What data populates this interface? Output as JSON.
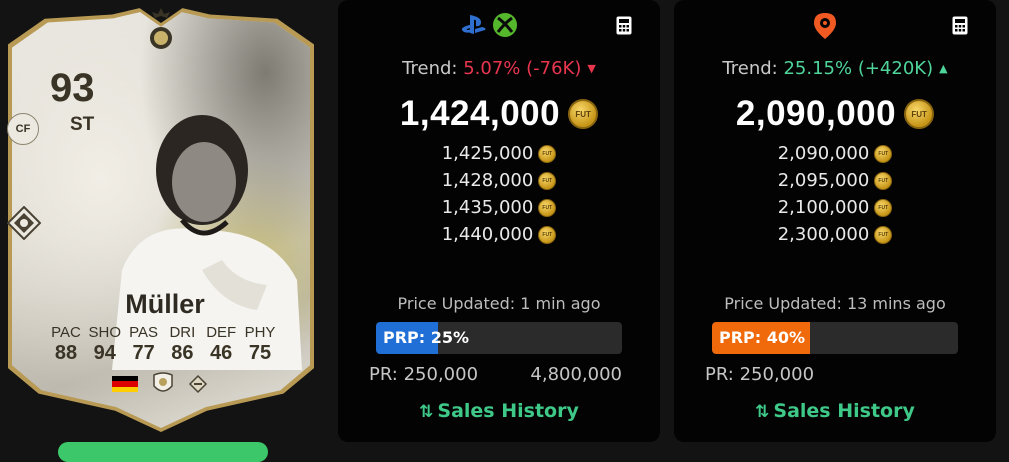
{
  "card": {
    "rating": "93",
    "position": "ST",
    "alt_position": "CF",
    "name": "Müller",
    "stats": [
      {
        "label": "PAC",
        "value": "88"
      },
      {
        "label": "SHO",
        "value": "94"
      },
      {
        "label": "PAS",
        "value": "77"
      },
      {
        "label": "DRI",
        "value": "86"
      },
      {
        "label": "DEF",
        "value": "46"
      },
      {
        "label": "PHY",
        "value": "75"
      }
    ],
    "nation_icon": "germany-flag-icon",
    "league_icon": "icons-league-icon",
    "club_icon": "icons-club-icon"
  },
  "panels": {
    "console": {
      "platform_icons": [
        "playstation-icon",
        "xbox-icon"
      ],
      "trend_label": "Trend:",
      "trend_value": "5.07% (-76K)",
      "trend_direction": "down",
      "price": "1,424,000",
      "coin_label": "FUT",
      "listings": [
        "1,425,000",
        "1,428,000",
        "1,435,000",
        "1,440,000"
      ],
      "updated": "Price Updated: 1 min ago",
      "prp_label": "PRP: 25%",
      "prp_fraction": 0.25,
      "prp_color": "#1f6fd6",
      "pr_min": "PR: 250,000",
      "pr_max": "4,800,000",
      "sales_label": "Sales History"
    },
    "pc": {
      "platform_icons": [
        "origin-icon"
      ],
      "trend_label": "Trend:",
      "trend_value": "25.15% (+420K)",
      "trend_direction": "up",
      "price": "2,090,000",
      "coin_label": "FUT",
      "listings": [
        "2,090,000",
        "2,095,000",
        "2,100,000",
        "2,300,000"
      ],
      "updated": "Price Updated: 13 mins ago",
      "prp_label": "PRP: 40%",
      "prp_fraction": 0.4,
      "prp_color": "#f06a0c",
      "pr_min": "PR: 250,000",
      "pr_max": "",
      "sales_label": "Sales History"
    }
  },
  "colors": {
    "trend_down": "#e8364f",
    "trend_up": "#4fd49a",
    "sales_link": "#3fc989",
    "panel_bg": "#030303"
  }
}
